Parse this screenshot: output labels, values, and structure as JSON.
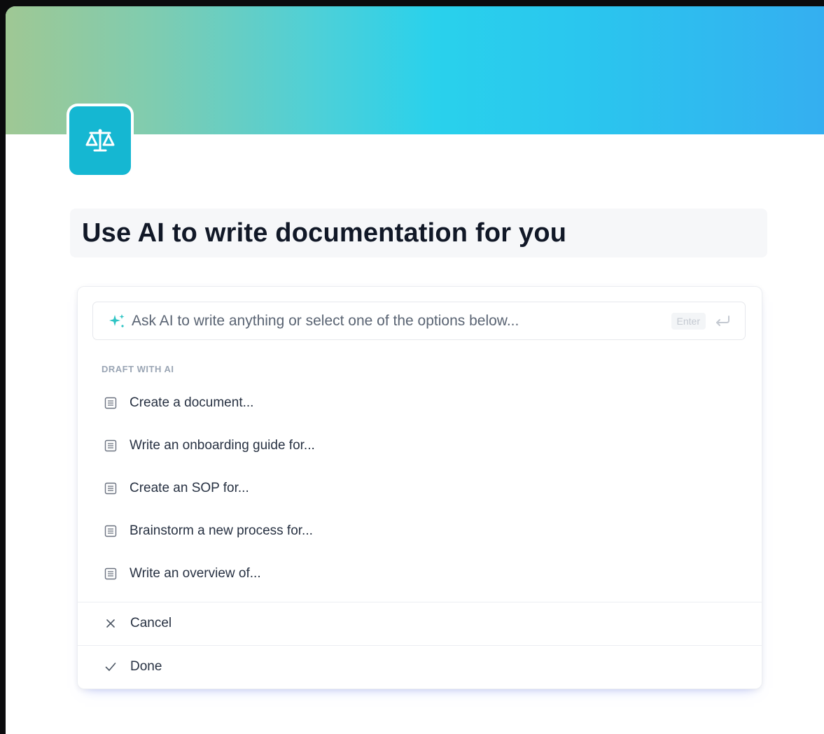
{
  "page": {
    "title": "Use AI to write documentation for you",
    "icon": "scales-icon"
  },
  "ai_panel": {
    "prompt": {
      "placeholder": "Ask AI to write anything or select one of the options below...",
      "value": "",
      "enter_label": "Enter"
    },
    "section_label": "DRAFT WITH AI",
    "items": [
      {
        "label": "Create a document...",
        "icon": "document-icon"
      },
      {
        "label": "Write an onboarding guide for...",
        "icon": "document-icon"
      },
      {
        "label": "Create an SOP for...",
        "icon": "document-icon"
      },
      {
        "label": "Brainstorm a new process for...",
        "icon": "document-icon"
      },
      {
        "label": "Write an overview of...",
        "icon": "document-icon"
      }
    ],
    "actions": {
      "cancel": {
        "label": "Cancel",
        "icon": "close-icon"
      },
      "done": {
        "label": "Done",
        "icon": "check-icon"
      }
    }
  },
  "colors": {
    "cover_gradient": [
      "#9fc894",
      "#29d1ec",
      "#35aef0"
    ],
    "icon_tile": "#15b7d2",
    "sparkle": "#2ec4c4"
  }
}
